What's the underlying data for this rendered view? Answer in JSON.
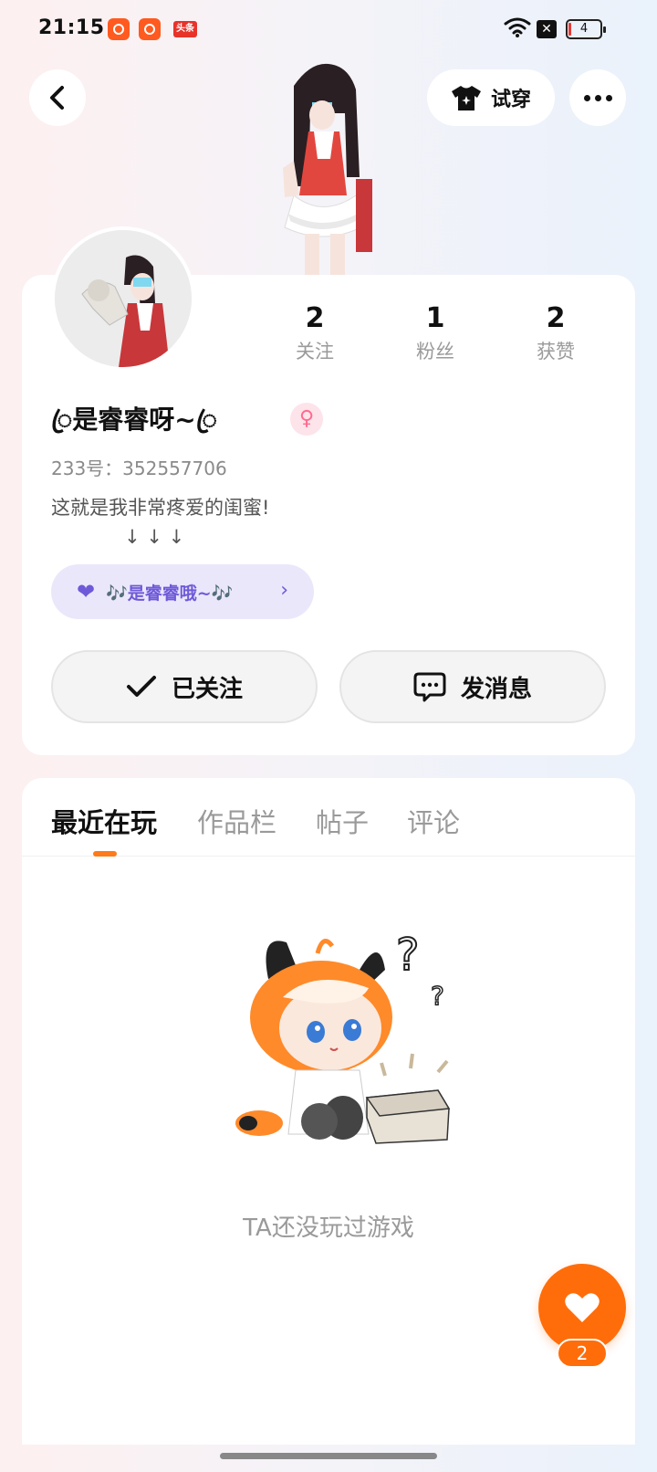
{
  "status_bar": {
    "time": "21:15",
    "news_app_label": "头条",
    "battery_level": "4",
    "icons": [
      "kuaishou-app-icon",
      "kuaishou-app-icon",
      "toutiao-app-icon",
      "wifi-icon",
      "x-icon",
      "battery-icon"
    ]
  },
  "header": {
    "back_icon": "chevron-left-icon",
    "tryon_label": "试穿",
    "tryon_icon": "tshirt-icon",
    "more_icon": "more-dots-icon"
  },
  "profile": {
    "stats": [
      {
        "value": "2",
        "label": "关注"
      },
      {
        "value": "1",
        "label": "粉丝"
      },
      {
        "value": "2",
        "label": "获赞"
      }
    ],
    "nickname": "ꦿ是睿睿呀~ꦿ",
    "gender": "♀",
    "uid": "233号：352557706",
    "bio": "这就是我非常疼爱的闺蜜!\n            ↓ ↓ ↓",
    "linked_friend": "🎶是睿睿哦~🎶",
    "linked_friend_icon": "heart-icon",
    "follow_label": "已关注",
    "message_label": "发消息"
  },
  "tabs": [
    "最近在玩",
    "作品栏",
    "帖子",
    "评论"
  ],
  "active_tab": 0,
  "empty_state": {
    "message": "TA还没玩过游戏"
  },
  "like_fab": {
    "count": "2",
    "icon": "heart-icon"
  },
  "colors": {
    "accent_orange": "#ff6d0a",
    "tag_purple": "#6e5ad8",
    "gender_pink": "#ff6a8e"
  }
}
